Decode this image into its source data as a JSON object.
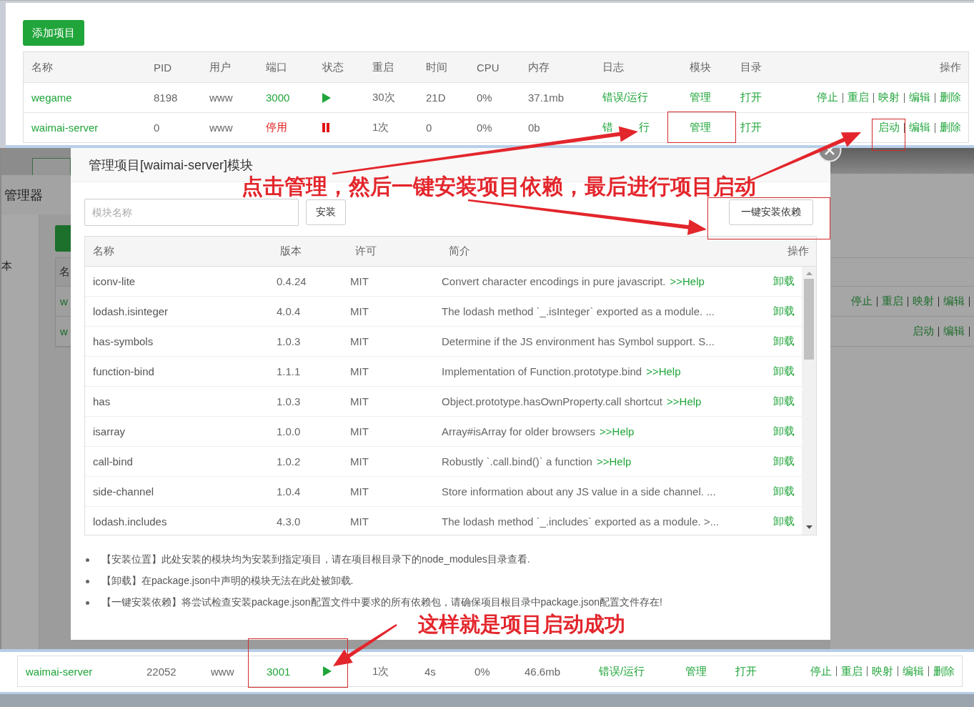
{
  "projects_panel": {
    "add_button": "添加项目",
    "columns": [
      "名称",
      "PID",
      "用户",
      "端口",
      "状态",
      "重启",
      "时间",
      "CPU",
      "内存",
      "日志",
      "模块",
      "目录",
      "操作"
    ],
    "rows": [
      {
        "name": "wegame",
        "pid": "8198",
        "user": "www",
        "port": "3000",
        "running": true,
        "restarts": "30次",
        "uptime": "21D",
        "cpu": "0%",
        "memory": "37.1mb",
        "log": "错误/运行",
        "module": "管理",
        "directory": "打开",
        "actions": [
          "停止",
          "重启",
          "映射",
          "编辑",
          "删除"
        ]
      },
      {
        "name": "waimai-server",
        "pid": "0",
        "user": "www",
        "port": "停用",
        "running": false,
        "restarts": "1次",
        "uptime": "0",
        "cpu": "0%",
        "memory": "0b",
        "log": "错 行",
        "module": "管理",
        "directory": "打开",
        "actions": [
          "启动",
          "编辑",
          "删除"
        ]
      }
    ]
  },
  "background_page": {
    "title": "管理器",
    "sidebar_items": [
      "本"
    ],
    "table": {
      "column_1": "名",
      "rows": [
        {
          "name": "w",
          "actions": [
            "停止",
            "重启",
            "映射",
            "编辑"
          ]
        },
        {
          "name": "w",
          "actions": [
            "启动",
            "编辑"
          ]
        }
      ]
    }
  },
  "modal": {
    "title": "管理项目[waimai-server]模块",
    "search": {
      "placeholder": "模块名称"
    },
    "install_button": "安装",
    "install_all_button": "一键安装依赖",
    "table": {
      "columns": [
        "名称",
        "版本",
        "许可",
        "简介",
        "操作"
      ],
      "rows": [
        {
          "name": "iconv-lite",
          "version": "0.4.24",
          "license": "MIT",
          "description": "Convert character encodings in pure javascript.",
          "help": ">>Help",
          "action": "卸载"
        },
        {
          "name": "lodash.isinteger",
          "version": "4.0.4",
          "license": "MIT",
          "description": "The lodash method `_.isInteger` exported as a module. ...",
          "action": "卸载"
        },
        {
          "name": "has-symbols",
          "version": "1.0.3",
          "license": "MIT",
          "description": "Determine if the JS environment has Symbol support. S...",
          "action": "卸载"
        },
        {
          "name": "function-bind",
          "version": "1.1.1",
          "license": "MIT",
          "description": "Implementation of Function.prototype.bind",
          "help": ">>Help",
          "action": "卸载"
        },
        {
          "name": "has",
          "version": "1.0.3",
          "license": "MIT",
          "description": "Object.prototype.hasOwnProperty.call shortcut",
          "help": ">>Help",
          "action": "卸载"
        },
        {
          "name": "isarray",
          "version": "1.0.0",
          "license": "MIT",
          "description": "Array#isArray for older browsers",
          "help": ">>Help",
          "action": "卸载"
        },
        {
          "name": "call-bind",
          "version": "1.0.2",
          "license": "MIT",
          "description": "Robustly `.call.bind()` a function",
          "help": ">>Help",
          "action": "卸载"
        },
        {
          "name": "side-channel",
          "version": "1.0.4",
          "license": "MIT",
          "description": "Store information about any JS value in a side channel. ...",
          "action": "卸载"
        },
        {
          "name": "lodash.includes",
          "version": "4.3.0",
          "license": "MIT",
          "description": "The lodash method `_.includes` exported as a module. >...",
          "action": "卸载"
        }
      ]
    },
    "notes": [
      "【安装位置】此处安装的模块均为安装到指定项目，请在项目根目录下的node_modules目录查看.",
      "【卸载】在package.json中声明的模块无法在此处被卸载.",
      "【一键安装依赖】将尝试检查安装package.json配置文件中要求的所有依赖包，请确保项目根目录中package.json配置文件存在!"
    ]
  },
  "annotations": {
    "instruction": "点击管理，然后一键安装项目依赖，最后进行项目启动",
    "result_caption": "这样就是项目启动成功"
  },
  "result_row": {
    "name": "waimai-server",
    "pid": "22052",
    "user": "www",
    "port": "3001",
    "running": true,
    "restarts": "1次",
    "uptime": "4s",
    "cpu": "0%",
    "memory": "46.6mb",
    "log": "错误/运行",
    "module": "管理",
    "directory": "打开",
    "actions": [
      "停止",
      "重启",
      "映射",
      "编辑",
      "删除"
    ]
  }
}
